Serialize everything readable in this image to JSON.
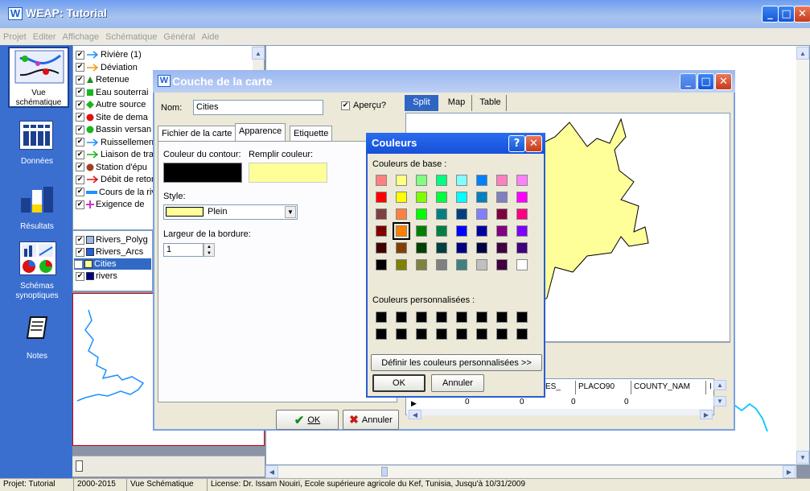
{
  "app": {
    "title": "WEAP: Tutorial"
  },
  "menu": [
    "Projet",
    "Editer",
    "Affichage",
    "Schématique",
    "Général",
    "Aide"
  ],
  "sidebar": {
    "items": [
      {
        "label": "Vue schématique",
        "icon": "schematic-icon"
      },
      {
        "label": "Données",
        "icon": "data-icon"
      },
      {
        "label": "Résultats",
        "icon": "results-icon"
      },
      {
        "label": "Schémas synoptiques",
        "icon": "synoptic-icon"
      },
      {
        "label": "Notes",
        "icon": "notes-icon"
      }
    ]
  },
  "legend": {
    "items": [
      {
        "label": "Rivière (1)",
        "icon": "arrow",
        "color": "#1e90ff"
      },
      {
        "label": "Déviation",
        "icon": "arrow",
        "color": "#f39c12"
      },
      {
        "label": "Retenue",
        "icon": "triangle",
        "color": "#1e8b1e"
      },
      {
        "label": "Eau souterrai",
        "icon": "square",
        "color": "#1bb61b"
      },
      {
        "label": "Autre source",
        "icon": "diamond",
        "color": "#1bb61b"
      },
      {
        "label": "Site de dema",
        "icon": "circle",
        "color": "#dd1111"
      },
      {
        "label": "Bassin versan",
        "icon": "circle",
        "color": "#1bb61b"
      },
      {
        "label": "Ruissellemen",
        "icon": "arrow",
        "color": "#1e90ff"
      },
      {
        "label": "Liaison de tra",
        "icon": "arrow",
        "color": "#1bb61b"
      },
      {
        "label": "Station d'épu",
        "icon": "circle",
        "color": "#a04020"
      },
      {
        "label": "Débit de retor",
        "icon": "arrow",
        "color": "#dd1111"
      },
      {
        "label": "Cours de la riv",
        "icon": "bar",
        "color": "#1e90ff"
      },
      {
        "label": "Exigence de",
        "icon": "plus",
        "color": "#cc33cc"
      }
    ]
  },
  "layers": {
    "items": [
      {
        "label": "Rivers_Polyg",
        "color": "#9db8e8",
        "selected": false
      },
      {
        "label": "Rivers_Arcs",
        "color": "#1f5fe0",
        "selected": false
      },
      {
        "label": "Cities",
        "color": "#ffff99",
        "selected": true
      },
      {
        "label": "rivers",
        "color": "#00008b",
        "selected": false
      }
    ]
  },
  "dialog": {
    "title": "Couche de la carte",
    "name_label": "Nom:",
    "name_value": "Cities",
    "preview_label": "Aperçu?",
    "tabs": [
      "Fichier de la carte",
      "Apparence",
      "Etiquette"
    ],
    "outline_label": "Couleur du contour:",
    "fill_label": "Remplir couleur:",
    "outline_color": "#000000",
    "fill_color": "#ffff99",
    "style_label": "Style:",
    "style_value": "Plein",
    "border_label": "Largeur de la bordure:",
    "border_value": "1",
    "view_tabs": [
      "Split",
      "Map",
      "Table"
    ],
    "ok_label": "OK",
    "cancel_label": "Annuler",
    "table": {
      "headers": [
        "ES_",
        "PLACO90",
        "COUNTY_NAM",
        "I"
      ],
      "row": [
        "0",
        "0",
        "0",
        "0"
      ]
    }
  },
  "colors_dialog": {
    "title": "Couleurs",
    "basic_label": "Couleurs de base :",
    "custom_label": "Couleurs personnalisées :",
    "define_label": "Définir les couleurs personnalisées >>",
    "ok_label": "OK",
    "cancel_label": "Annuler",
    "basic": [
      "#ff8080",
      "#ffff80",
      "#80ff80",
      "#00ff80",
      "#80ffff",
      "#0080ff",
      "#ff80c0",
      "#ff80ff",
      "#ff0000",
      "#ffff00",
      "#80ff00",
      "#00ff40",
      "#00ffff",
      "#0080c0",
      "#8080c0",
      "#ff00ff",
      "#804040",
      "#ff8040",
      "#00ff00",
      "#008080",
      "#004080",
      "#8080ff",
      "#800040",
      "#ff0080",
      "#800000",
      "#ff8000",
      "#008000",
      "#008040",
      "#0000ff",
      "#0000a0",
      "#800080",
      "#8000ff",
      "#400000",
      "#804000",
      "#004000",
      "#004040",
      "#000080",
      "#000040",
      "#400040",
      "#400080",
      "#000000",
      "#808000",
      "#808040",
      "#808080",
      "#408080",
      "#c0c0c0",
      "#400040",
      "#ffffff"
    ],
    "selected_index": 25
  },
  "status": {
    "project": "Projet: Tutorial",
    "years": "2000-2015",
    "view": "Vue Schématique",
    "license": "License: Dr. Issam Nouiri, Ecole supérieure agricole du Kef, Tunisia, Jusqu'à 10/31/2009"
  }
}
